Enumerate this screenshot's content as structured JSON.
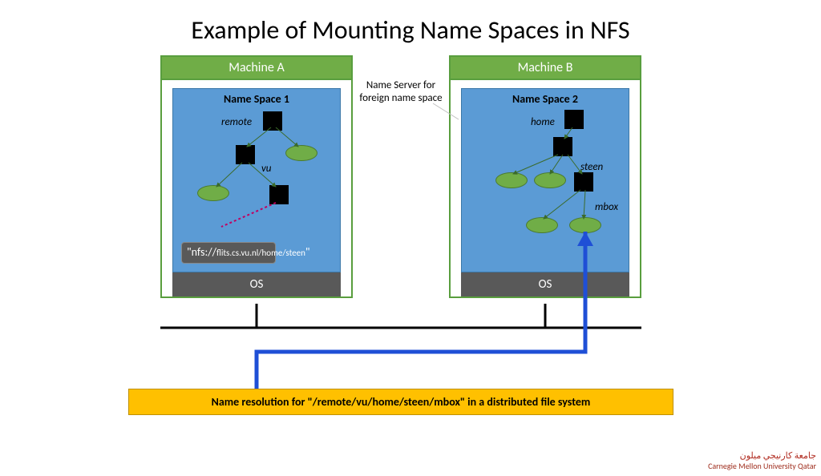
{
  "title": "Example of Mounting Name Spaces in NFS",
  "mid_label": "Name Server for foreign name space",
  "machine_a": {
    "header": "Machine A",
    "namespace_label": "Name Space 1",
    "os_label": "OS",
    "node_labels": {
      "remote": "remote",
      "vu": "vu"
    },
    "nfs_url_prefix": "\"nfs://",
    "nfs_url_rest": "flits.cs.vu.nl/home/steen",
    "nfs_url_suffix": "\""
  },
  "machine_b": {
    "header": "Machine B",
    "namespace_label": "Name Space 2",
    "os_label": "OS",
    "node_labels": {
      "home": "home",
      "steen": "steen",
      "mbox": "mbox"
    }
  },
  "caption": "Name resolution for \"/remote/vu/home/steen/mbox\" in a distributed file system",
  "logo": {
    "arabic": "جامعة كارنيجي ميلون",
    "eng": "Carnegie Mellon University Qatar"
  },
  "colors": {
    "green": "#70ad47",
    "blue": "#5b9bd5",
    "grey": "#595959",
    "gold": "#ffc000"
  }
}
